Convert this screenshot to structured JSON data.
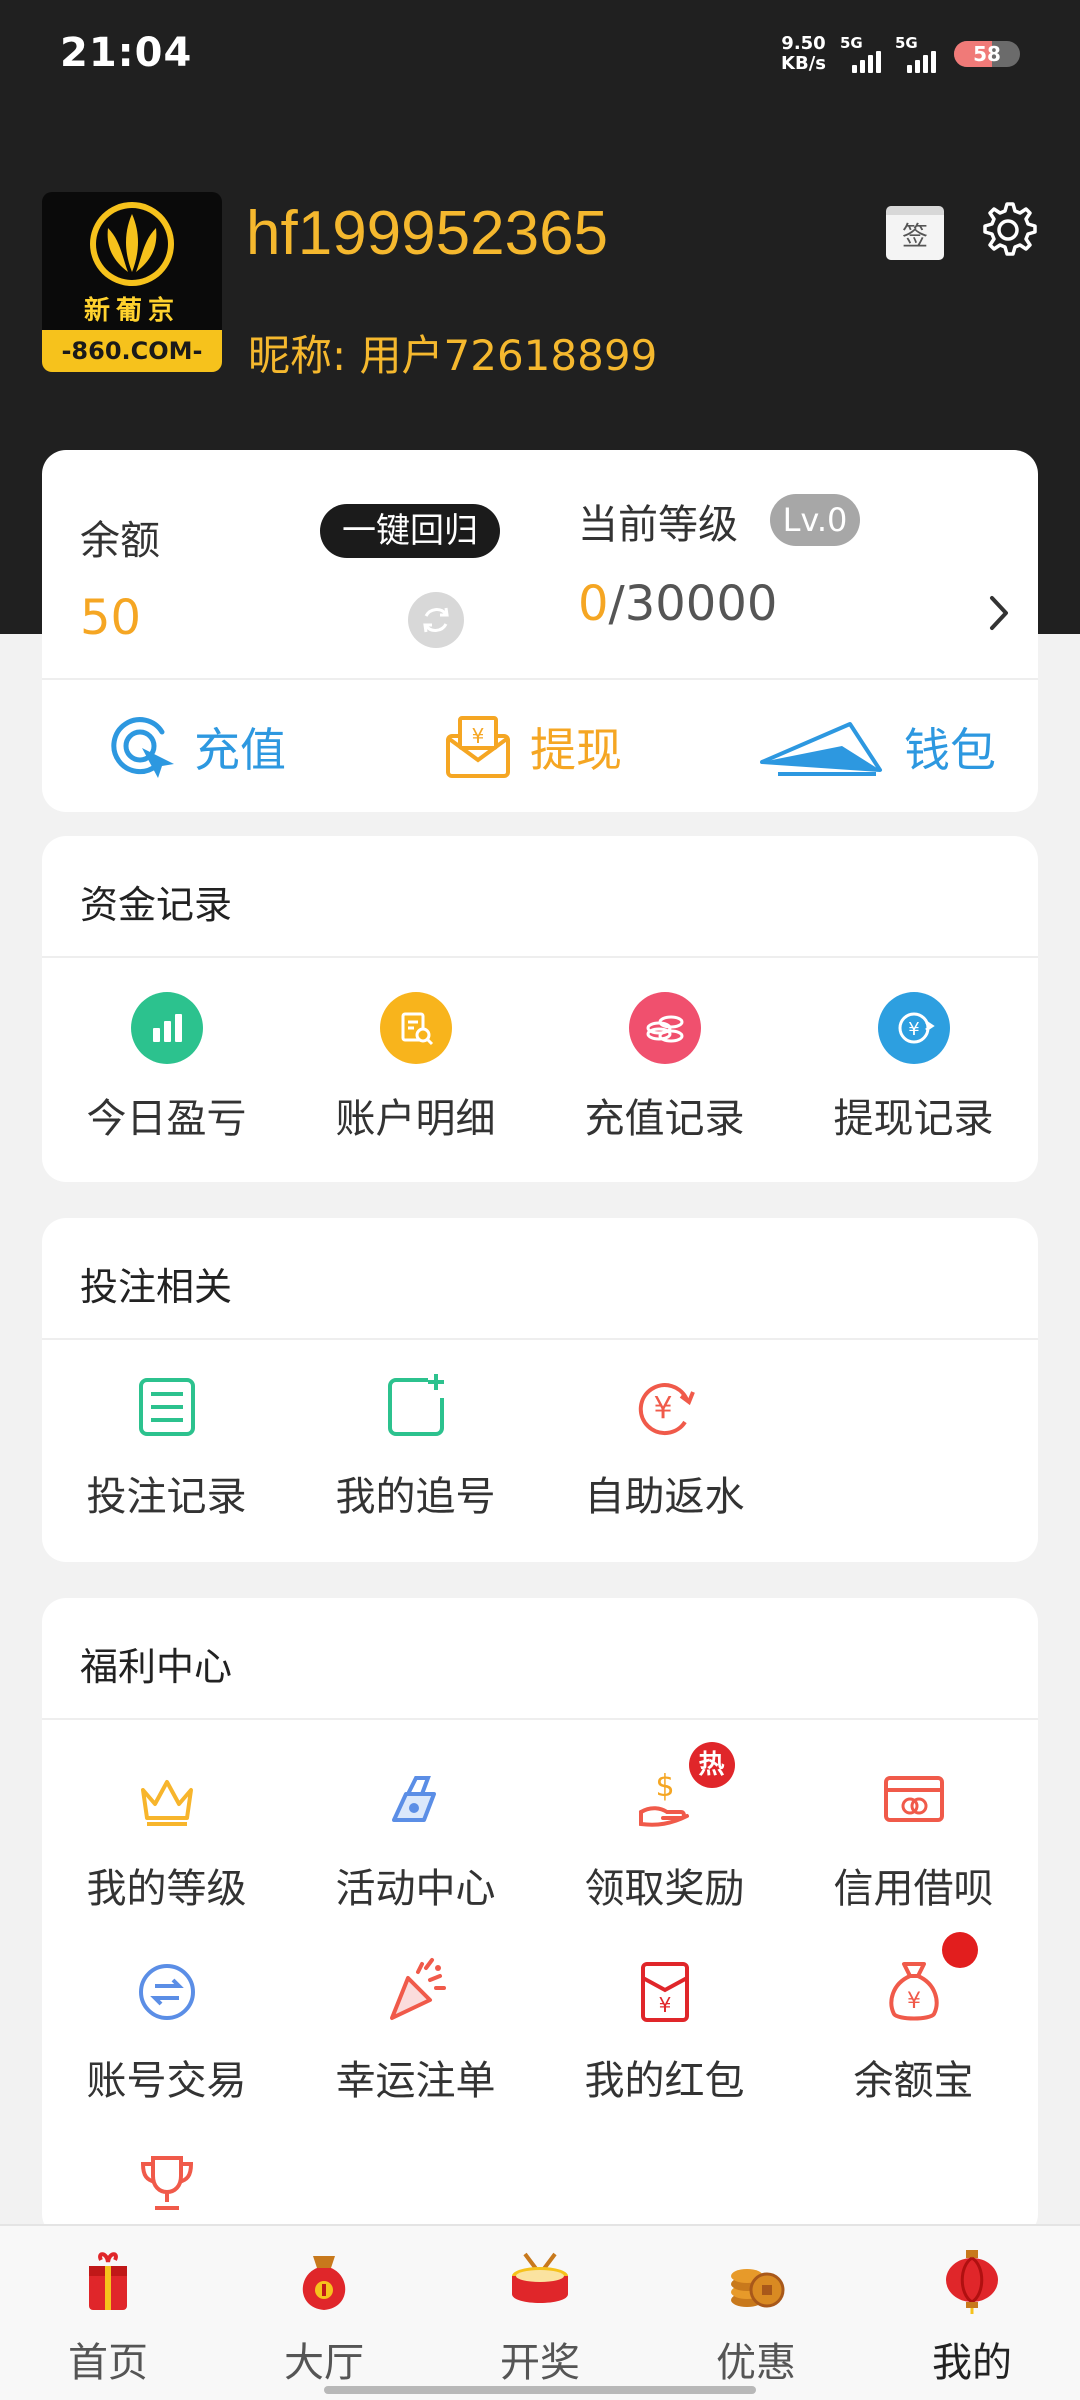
{
  "status_bar": {
    "time": "21:04",
    "net_speed_value": "9.50",
    "net_speed_unit": "KB/s",
    "sim1_label": "5G",
    "sim2_label": "5G",
    "battery": "58"
  },
  "profile": {
    "logo_cn": "新葡京",
    "logo_url": "-860.COM-",
    "username": "hf199952365",
    "nickname_label": "昵称:",
    "nickname_value": "用户72618899",
    "sign_in_label": "签",
    "settings_icon": "gear-icon"
  },
  "balance": {
    "label": "余额",
    "value": "50",
    "recall_button": "一键回归",
    "level_label": "当前等级",
    "level_badge": "Lv.0",
    "level_current": "0",
    "level_target": "/30000",
    "actions": [
      {
        "label": "充值",
        "icon": "recharge-icon",
        "color": "#2d98e0"
      },
      {
        "label": "提现",
        "icon": "withdraw-icon",
        "color": "#f5a623"
      },
      {
        "label": "钱包",
        "icon": "wallet-icon",
        "color": "#2d98e0"
      }
    ]
  },
  "fund_records": {
    "title": "资金记录",
    "items": [
      {
        "label": "今日盈亏",
        "icon": "chart-bars-icon",
        "color": "#2cc28e"
      },
      {
        "label": "账户明细",
        "icon": "document-search-icon",
        "color": "#f8b41c"
      },
      {
        "label": "充值记录",
        "icon": "coins-icon",
        "color": "#f0506e"
      },
      {
        "label": "提现记录",
        "icon": "yen-exchange-icon",
        "color": "#2d9fe0"
      }
    ]
  },
  "bet_related": {
    "title": "投注相关",
    "items": [
      {
        "label": "投注记录",
        "icon": "list-icon"
      },
      {
        "label": "我的追号",
        "icon": "add-square-icon"
      },
      {
        "label": "自助返水",
        "icon": "yen-refresh-icon"
      }
    ]
  },
  "welfare_center": {
    "title": "福利中心",
    "hot_badge": "热",
    "items": [
      {
        "label": "我的等级",
        "icon": "crown-icon"
      },
      {
        "label": "活动中心",
        "icon": "activity-icon"
      },
      {
        "label": "领取奖励",
        "icon": "reward-hand-icon"
      },
      {
        "label": "信用借呗",
        "icon": "credit-card-icon"
      },
      {
        "label": "账号交易",
        "icon": "swap-icon"
      },
      {
        "label": "幸运注单",
        "icon": "party-popper-icon"
      },
      {
        "label": "我的红包",
        "icon": "red-envelope-icon"
      },
      {
        "label": "余额宝",
        "icon": "money-bag-icon"
      },
      {
        "label": "",
        "icon": "trophy-icon"
      }
    ]
  },
  "bottom_nav": {
    "items": [
      {
        "label": "首页",
        "icon": "gift-box-icon"
      },
      {
        "label": "大厅",
        "icon": "lucky-bag-icon"
      },
      {
        "label": "开奖",
        "icon": "drum-icon"
      },
      {
        "label": "优惠",
        "icon": "coin-stack-icon"
      },
      {
        "label": "我的",
        "icon": "lantern-icon"
      }
    ],
    "active": "我的"
  }
}
